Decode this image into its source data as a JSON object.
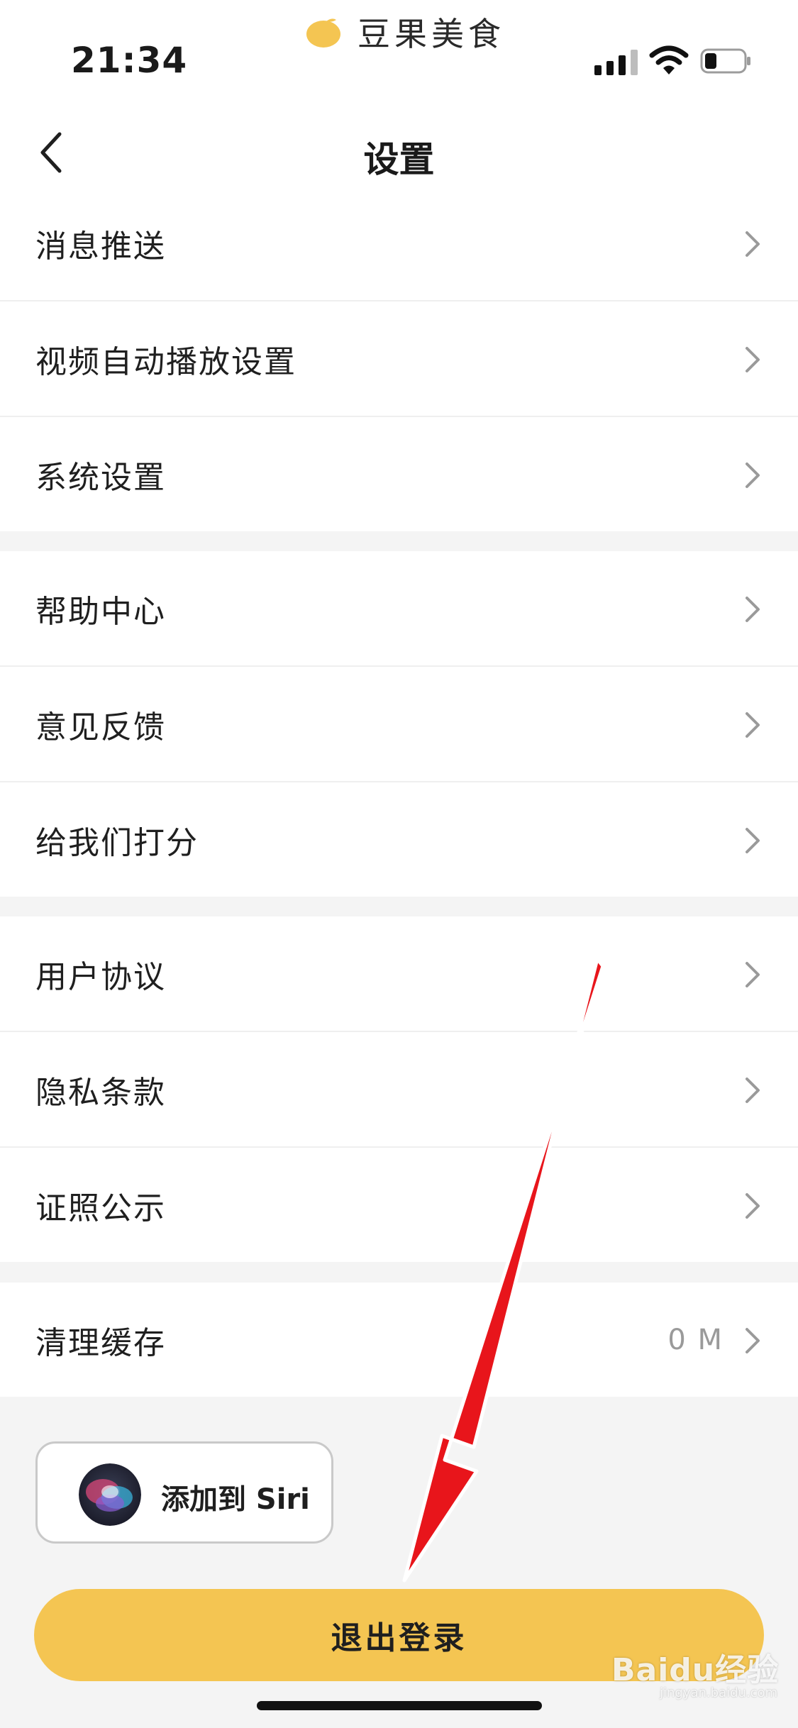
{
  "status_bar": {
    "time": "21:34",
    "app_name": "豆果美食"
  },
  "navbar": {
    "title": "设置"
  },
  "sections": [
    {
      "items": [
        {
          "label": "消息推送",
          "value": ""
        },
        {
          "label": "视频自动播放设置",
          "value": ""
        },
        {
          "label": "系统设置",
          "value": ""
        }
      ]
    },
    {
      "items": [
        {
          "label": "帮助中心",
          "value": ""
        },
        {
          "label": "意见反馈",
          "value": ""
        },
        {
          "label": "给我们打分",
          "value": ""
        }
      ]
    },
    {
      "items": [
        {
          "label": "用户协议",
          "value": ""
        },
        {
          "label": "隐私条款",
          "value": ""
        },
        {
          "label": "证照公示",
          "value": ""
        }
      ]
    },
    {
      "items": [
        {
          "label": "清理缓存",
          "value": "0 M"
        }
      ]
    }
  ],
  "siri_button": {
    "label": "添加到 Siri"
  },
  "logout_button": {
    "label": "退出登录"
  },
  "watermark": {
    "text": "Baidu经验",
    "sub": "jingyan.baidu.com"
  },
  "colors": {
    "accent": "#f4c552",
    "background": "#f4f4f4",
    "annotation_arrow": "#e8151b"
  },
  "icons": {
    "back": "chevron-left-icon",
    "row_arrow": "chevron-right-icon",
    "signal": "cellular-signal-icon",
    "wifi": "wifi-icon",
    "battery": "battery-icon",
    "siri": "siri-icon",
    "app_logo": "mango-logo-icon"
  }
}
